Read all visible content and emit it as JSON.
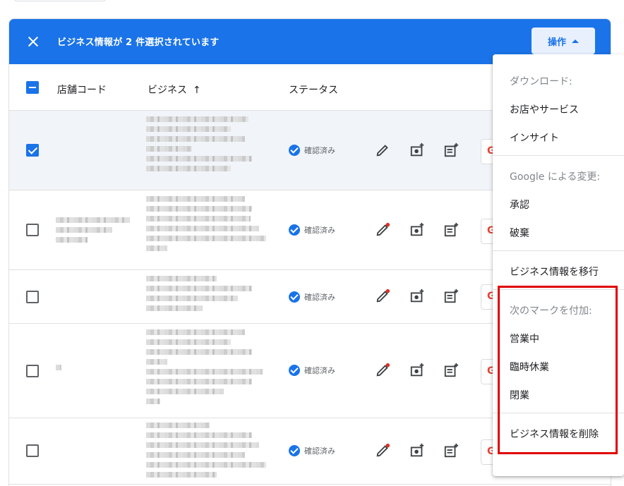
{
  "banner": {
    "selection_text": "ビジネス情報が 2 件選択されています",
    "ops_label": "操作"
  },
  "table": {
    "headers": {
      "store_code": "店舗コード",
      "business": "ビジネス",
      "status": "ステータス"
    },
    "rows": [
      {
        "status": "確認済み",
        "checked": true
      },
      {
        "status": "確認済み",
        "checked": false
      },
      {
        "status": "確認済み",
        "checked": false
      },
      {
        "status": "確認済み",
        "checked": false
      },
      {
        "status": "確認済み",
        "checked": false
      }
    ]
  },
  "menu": {
    "download_header": "ダウンロード:",
    "download_items": [
      "お店やサービス",
      "インサイト"
    ],
    "google_header": "Google による変更:",
    "google_items": [
      "承認",
      "破棄"
    ],
    "move_item": "ビジネス情報を移行",
    "mark_header": "次のマークを付加:",
    "mark_items": [
      "営業中",
      "臨時休業",
      "閉業"
    ],
    "delete_item": "ビジネス情報を削除"
  },
  "colors": {
    "accent": "#1a73e8",
    "highlight_box": "#e00000"
  }
}
